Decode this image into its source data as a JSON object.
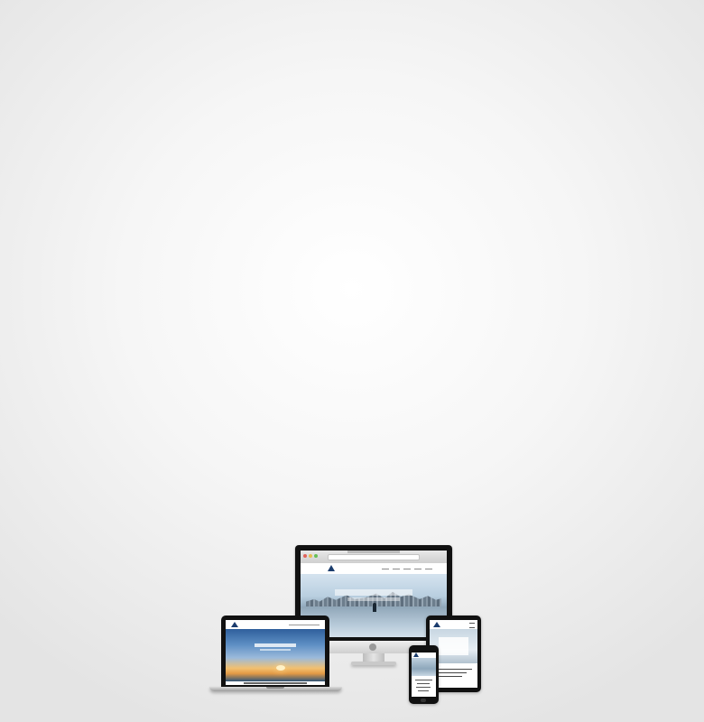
{
  "scene": {
    "devices": [
      "desktop-monitor",
      "laptop",
      "tablet",
      "smartphone"
    ]
  },
  "colors": {
    "background": "#f4f4f4",
    "device_frame": "#111111",
    "brand_navy": "#1b3c6d"
  }
}
